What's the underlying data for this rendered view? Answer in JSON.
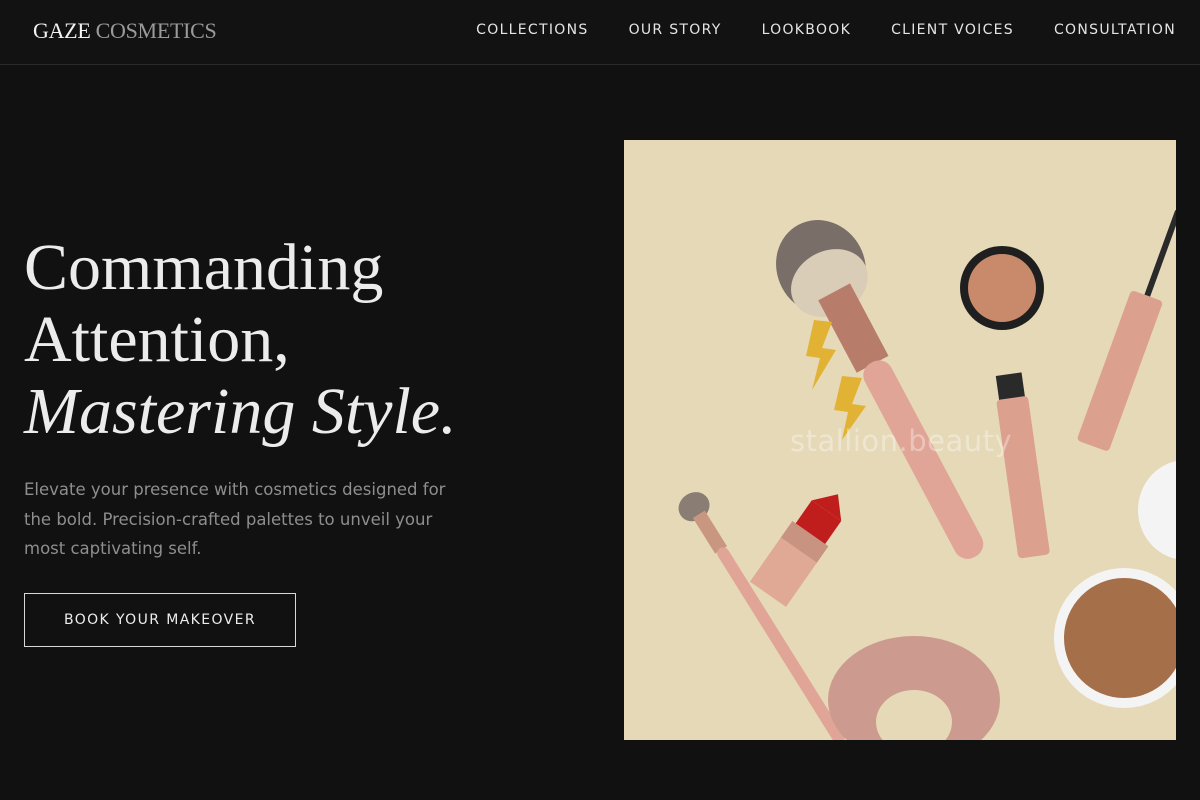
{
  "brand": {
    "name_primary": "GAZE",
    "name_secondary": "COSMETICS"
  },
  "nav": {
    "items": [
      {
        "label": "COLLECTIONS"
      },
      {
        "label": "OUR STORY"
      },
      {
        "label": "LOOKBOOK"
      },
      {
        "label": "CLIENT VOICES"
      },
      {
        "label": "CONSULTATION"
      }
    ]
  },
  "hero": {
    "headline_line1": "Commanding",
    "headline_line2": "Attention,",
    "headline_line3": "Mastering Style.",
    "subtext": "Elevate your presence with cosmetics designed for the bold. Precision-crafted palettes to unveil your most captivating self.",
    "cta_label": "BOOK YOUR MAKEOVER",
    "image_watermark": "stallion.beauty"
  },
  "colors": {
    "background": "#111111",
    "image_background": "#e6d9b8",
    "accent_rose": "#e0a596"
  }
}
